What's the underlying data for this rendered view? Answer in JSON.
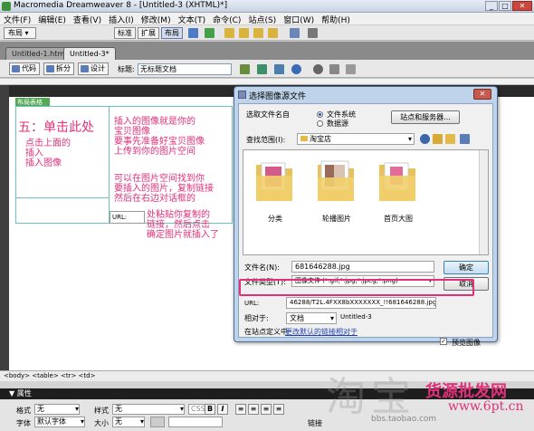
{
  "window": {
    "title": "Macromedia Dreamweaver 8 - [Untitled-3 (XHTML)*]",
    "controls": [
      "_",
      "□",
      "✕"
    ]
  },
  "menu": [
    "文件(F)",
    "编辑(E)",
    "查看(V)",
    "插入(I)",
    "修改(M)",
    "文本(T)",
    "命令(C)",
    "站点(S)",
    "窗口(W)",
    "帮助(H)"
  ],
  "insert_bar": {
    "category": "布局",
    "modes": [
      "标准",
      "扩展",
      "布局"
    ]
  },
  "doc_tabs": [
    "Untitled-1.html",
    "Untitled-3*"
  ],
  "doc_toolbar": {
    "code": "代码",
    "split": "拆分",
    "design": "设计",
    "title_label": "标题:",
    "title_value": "无标题文档"
  },
  "design": {
    "table_tag": "布局表格",
    "step_title": "五：单击此处",
    "left_note": [
      "点击上面的",
      "插入",
      "插入图像"
    ],
    "right_notes": [
      "插入的图像就是你的",
      "宝贝图像",
      "要事先准备好宝贝图像",
      "上传到你的图片空间"
    ],
    "right_notes2": [
      "可以在图片空间找到你",
      "要插入的图片，复制链接",
      "然后在右边对话框的"
    ],
    "url_box": "URL:",
    "right_notes3": [
      "处粘贴你复制的",
      "链接，然后点击",
      "确定图片就插入了"
    ]
  },
  "dialog": {
    "title": "选择图像源文件",
    "select_from": "选取文件名自",
    "radio_filesystem": "文件系统",
    "radio_datasource": "数据源",
    "sites_button": "站点和服务器...",
    "look_in_label": "查找范围(I):",
    "look_in_value": "淘宝店",
    "folders": [
      "分类",
      "轮播图片",
      "首页大图"
    ],
    "filename_label": "文件名(N):",
    "filename_value": "681646288.jpg",
    "filetype_label": "文件类型(T):",
    "filetype_value": "图像文件 (*.gif;*.jpg;*.jpeg;*.png)",
    "ok": "确定",
    "cancel": "取消",
    "url_label": "URL:",
    "url_value": "46288/T2L.4FXX8bXXXXXXX_!!681646288.jpg",
    "relative_label": "相对于:",
    "relative_value": "文档",
    "relative_doc": "Untitled-3",
    "site_def_text": "在站点定义中",
    "site_def_link": "更改默认的链接相对于",
    "preview_label": "预览图像"
  },
  "status": {
    "tags": "<body> <table> <tr> <td>"
  },
  "properties": {
    "title": "属性",
    "format_label": "格式",
    "format_value": "无",
    "style_label": "样式",
    "style_value": "无",
    "css_label": "CSS",
    "bold": "B",
    "italic": "I",
    "font_label": "字体",
    "font_value": "默认字体",
    "size_label": "大小",
    "size_value": "无",
    "link_label": "链接"
  },
  "watermark": {
    "big": "淘宝",
    "text1": "货源批发网",
    "text2": "www.6pt.cn",
    "small": "bbs.taobao.com"
  },
  "colors": {
    "accent": "#e0307a",
    "dialog": "#bfd3ea"
  }
}
